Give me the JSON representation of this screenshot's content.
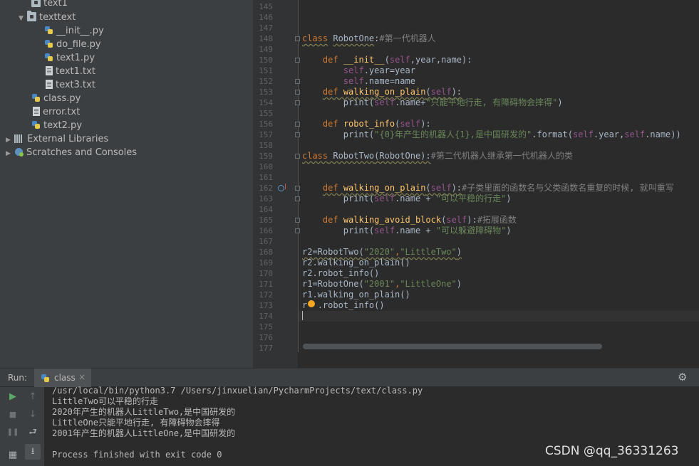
{
  "project_tree": {
    "items": [
      {
        "label": "text1",
        "icon": "folder-icon"
      },
      {
        "label": "texttext",
        "icon": "folder-icon"
      },
      {
        "label": "__init__.py",
        "icon": "python-file-icon"
      },
      {
        "label": "do_file.py",
        "icon": "python-file-icon"
      },
      {
        "label": "text1.py",
        "icon": "python-file-icon"
      },
      {
        "label": "text1.txt",
        "icon": "text-file-icon"
      },
      {
        "label": "text3.txt",
        "icon": "text-file-icon"
      },
      {
        "label": "class.py",
        "icon": "python-file-icon"
      },
      {
        "label": "error.txt",
        "icon": "text-file-icon"
      },
      {
        "label": "text2.py",
        "icon": "python-file-icon"
      },
      {
        "label": "External Libraries",
        "icon": "library-icon"
      },
      {
        "label": "Scratches and Consoles",
        "icon": "scratches-icon"
      }
    ]
  },
  "editor": {
    "line_numbers": [
      "145",
      "146",
      "147",
      "148",
      "149",
      "150",
      "151",
      "152",
      "153",
      "154",
      "155",
      "156",
      "157",
      "158",
      "159",
      "160",
      "161",
      "162",
      "163",
      "164",
      "165",
      "166",
      "167",
      "168",
      "169",
      "170",
      "171",
      "172",
      "173",
      "174",
      "175",
      "176",
      "177"
    ],
    "code": {
      "l148_kw": "class",
      "l148_name": "RobotOne",
      "l148_colon": ":",
      "l148_comment": "#第一代机器人",
      "l150_def": "def",
      "l150_fn": "__init__",
      "l150_open": "(",
      "l150_self": "self",
      "l150_args": ",year,name):",
      "l151_self": "self",
      "l151_rest": ".year=year",
      "l152_self": "self",
      "l152_rest": ".name=name",
      "l153_def": "def",
      "l153_fn": "walking_on_plain",
      "l153_open": "(",
      "l153_self": "self",
      "l153_close": "):",
      "l154_print": "print(",
      "l154_self": "self",
      "l154_mid": ".name+",
      "l154_str": "\"只能平地行走, 有障碍物会摔得\"",
      "l154_close": ")",
      "l156_def": "def",
      "l156_fn": "robot_info",
      "l156_open": "(",
      "l156_self": "self",
      "l156_close": "):",
      "l157_print": "print(",
      "l157_str": "\"{0}年产生的机器人{1},是中国研发的\"",
      "l157_mid": ".format(",
      "l157_self1": "self",
      "l157_year": ".year,",
      "l157_self2": "self",
      "l157_close": ".name))",
      "l159_kw": "class",
      "l159_name": "RobotTwo",
      "l159_paren": "(RobotOne):",
      "l159_comment": "#第二代机器人继承第一代机器人的类",
      "l162_def": "def",
      "l162_fn": "walking_on_plain",
      "l162_open": "(",
      "l162_self": "self",
      "l162_close": "):",
      "l162_comment": "#子类里面的函数名与父类函数名重复的时候, 就叫重写",
      "l163_print": "print(",
      "l163_self": "self",
      "l163_mid": ".name + ",
      "l163_str": "\"可以平稳的行走\"",
      "l163_close": ")",
      "l165_def": "def",
      "l165_fn": "walking_avoid_block",
      "l165_open": "(",
      "l165_self": "self",
      "l165_close": "):",
      "l165_comment": "#拓展函数",
      "l166_print": "print(",
      "l166_self": "self",
      "l166_mid": ".name + ",
      "l166_str": "\"可以躲避障碍物\"",
      "l166_close": ")",
      "l168_pre": "r2=RobotTwo(",
      "l168_s1": "\"2020\"",
      "l168_comma": ",",
      "l168_s2": "\"LittleTwo\"",
      "l168_close": ")",
      "l169": "r2.walking_on_plain()",
      "l170": "r2.robot_info()",
      "l171_pre": "r1=RobotOne(",
      "l171_s1": "\"2001\"",
      "l171_comma": ",",
      "l171_s2": "\"LittleOne\"",
      "l171_close": ")",
      "l172": "r1.walking_on_plain()",
      "l173_pre": "r",
      "l173_rest": ".robot_info()"
    }
  },
  "run_panel": {
    "label": "Run:",
    "tab_title": "class",
    "tab_close": "×",
    "console_lines": [
      "/usr/local/bin/python3.7 /Users/jinxuelian/PycharmProjects/text/class.py",
      "LittleTwo可以平稳的行走",
      "2020年产生的机器人LittleTwo,是中国研发的",
      "LittleOne只能平地行走, 有障碍物会摔得",
      "2001年产生的机器人LittleOne,是中国研发的",
      "",
      "Process finished with exit code 0"
    ],
    "buttons": {
      "run": "▶",
      "up": "↑",
      "stop": "■",
      "down": "↓",
      "pause": "❚❚",
      "wrap": "⮐",
      "layout": "▦",
      "scroll_end": "⭳"
    },
    "gear": "⚙"
  },
  "watermark": "CSDN @qq_36331263",
  "colors": {
    "keyword": "#cc7832",
    "function": "#ffc66d",
    "self": "#94558d",
    "string": "#6a8759",
    "comment": "#808080",
    "text": "#a9b7c6",
    "run_green": "#59a869"
  }
}
